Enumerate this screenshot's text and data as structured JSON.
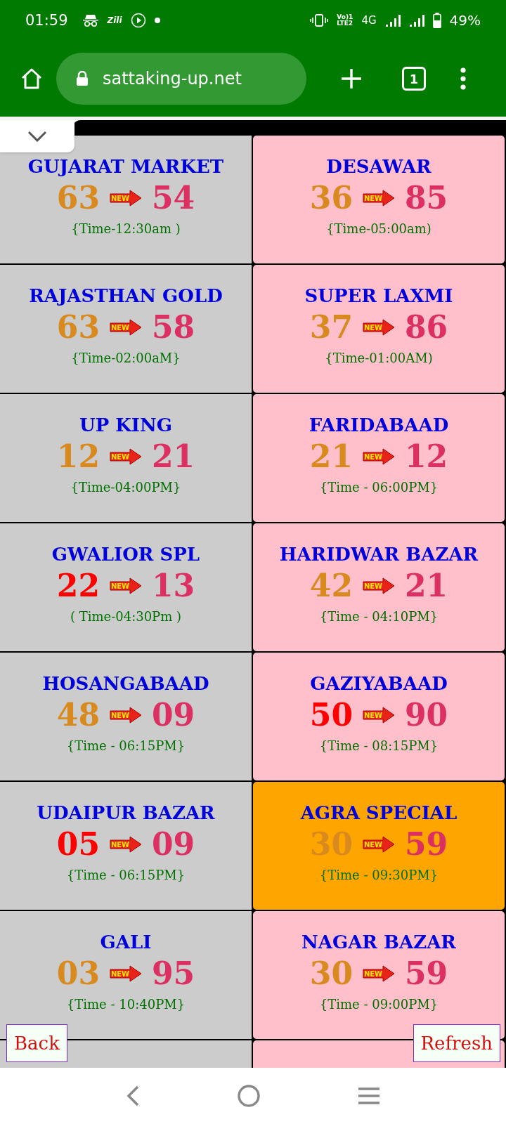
{
  "status_bar": {
    "time": "01:59",
    "app_label": "Zili",
    "volte_top": "Vo)1",
    "volte_bottom": "LTE2",
    "network": "4G",
    "battery": "49%"
  },
  "browser": {
    "url": "sattaking-up.net",
    "tab_count": "1"
  },
  "cards": [
    {
      "title": "GUJARAT MARKET",
      "old": {
        "text": "63",
        "color": "#d98a1e"
      },
      "badge": "NEW",
      "new": "54",
      "time": "{Time-12:30am )",
      "color": "#cccccc"
    },
    {
      "title": "DESAWAR",
      "old": {
        "text": "36",
        "color": "#d98a1e"
      },
      "badge": "NEW",
      "new": "85",
      "time": "{Time-05:00am)",
      "color": "#ffc0cb"
    },
    {
      "title": "RAJASTHAN GOLD",
      "old": {
        "text": "63",
        "color": "#d98a1e"
      },
      "badge": "NEW",
      "new": "58",
      "time": "{Time-02:00aM}",
      "color": "#cccccc"
    },
    {
      "title": "SUPER LAXMI",
      "old": {
        "text": "37",
        "color": "#d98a1e"
      },
      "badge": "NEW",
      "new": "86",
      "time": "{Time-01:00AM)",
      "color": "#ffc0cb"
    },
    {
      "title": "UP KING",
      "old": {
        "text": "12",
        "color": "#d98a1e"
      },
      "badge": "NEW",
      "new": "21",
      "time": "{Time-04:00PM}",
      "color": "#cccccc"
    },
    {
      "title": "FARIDABAAD",
      "old": {
        "text": "21",
        "color": "#d98a1e"
      },
      "badge": "NEW",
      "new": "12",
      "time": "{Time - 06:00PM}",
      "color": "#ffc0cb"
    },
    {
      "title": "GWALIOR SPL",
      "old": {
        "text": "22",
        "color": "#ff0000"
      },
      "badge": "NEW",
      "new": "13",
      "time": "( Time-04:30Pm )",
      "color": "#cccccc"
    },
    {
      "title": "HARIDWAR BAZAR",
      "old": {
        "text": "42",
        "color": "#d98a1e"
      },
      "badge": "NEW",
      "new": "21",
      "time": "{Time - 04:10PM}",
      "color": "#ffc0cb"
    },
    {
      "title": "HOSANGABAAD",
      "old": {
        "text": "48",
        "color": "#d98a1e"
      },
      "badge": "NEW",
      "new": "09",
      "time": "{Time - 06:15PM}",
      "color": "#cccccc"
    },
    {
      "title": "GAZIYABAAD",
      "old": {
        "text": "50",
        "color": "#ff0000"
      },
      "badge": "NEW",
      "new": "90",
      "time": "{Time - 08:15PM}",
      "color": "#ffc0cb"
    },
    {
      "title": "UDAIPUR BAZAR",
      "old": {
        "text": "05",
        "color": "#ff0000"
      },
      "badge": "NEW",
      "new": "09",
      "time": "{Time - 06:15PM}",
      "color": "#cccccc"
    },
    {
      "title": "AGRA SPECIAL",
      "old": {
        "text": "30",
        "color": "#d98a1e"
      },
      "badge": "NEW",
      "new": "59",
      "time": "{Time - 09:30PM}",
      "color": "#ffa500"
    },
    {
      "title": "GALI",
      "old": {
        "text": "03",
        "color": "#d98a1e"
      },
      "badge": "NEW",
      "new": "95",
      "time": "{Time - 10:40PM}",
      "color": "#cccccc"
    },
    {
      "title": "NAGAR BAZAR",
      "old": {
        "text": "30",
        "color": "#d98a1e"
      },
      "badge": "NEW",
      "new": "59",
      "time": "{Time - 09:00PM}",
      "color": "#ffc0cb"
    },
    {
      "color": "#cccccc"
    },
    {
      "color": "#ffc0cb"
    }
  ],
  "buttons": {
    "back": "Back",
    "refresh": "Refresh"
  }
}
